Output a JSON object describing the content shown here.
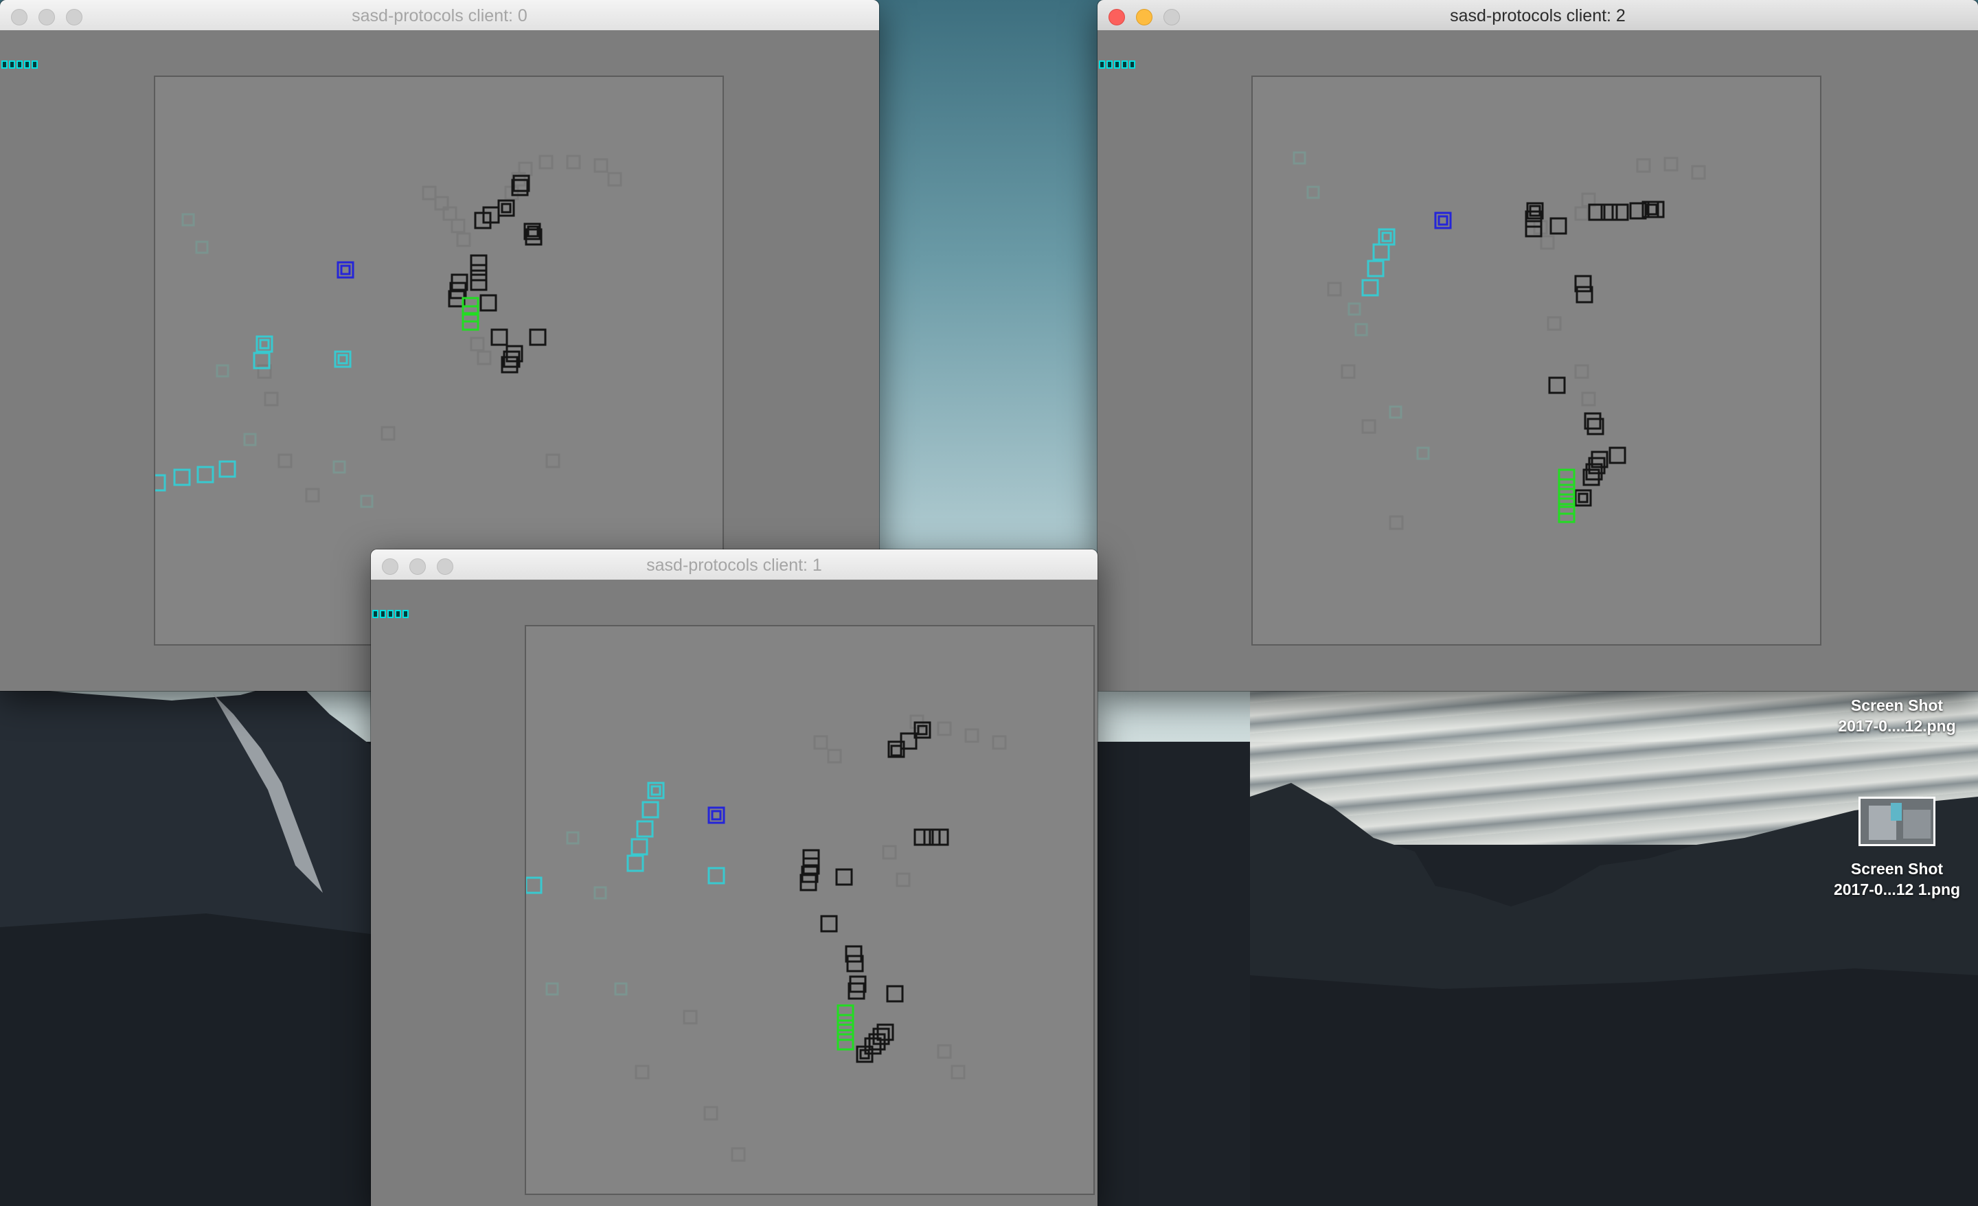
{
  "windows": [
    {
      "id": "client-0",
      "title": "sasd-protocols client: 0",
      "active": false
    },
    {
      "id": "client-1",
      "title": "sasd-protocols client: 1",
      "active": false
    },
    {
      "id": "client-2",
      "title": "sasd-protocols client: 2",
      "active": true
    }
  ],
  "desktop": {
    "icons": [
      {
        "name": "Screen Shot",
        "file": "2017-0....12.png"
      },
      {
        "name": "Screen Shot",
        "file": "2017-0...12 1.png"
      }
    ]
  },
  "colors": {
    "cyan": "#39c9cf",
    "blue": "#2020e0",
    "green": "#22dd22",
    "black": "#151515",
    "window_bg": "#7d7d7d",
    "canvas_bg": "#848484",
    "indicator": "#00e0e0"
  },
  "icons": {
    "close": "close-icon",
    "minimize": "minimize-icon",
    "zoom": "zoom-icon",
    "file": "file-icon"
  }
}
